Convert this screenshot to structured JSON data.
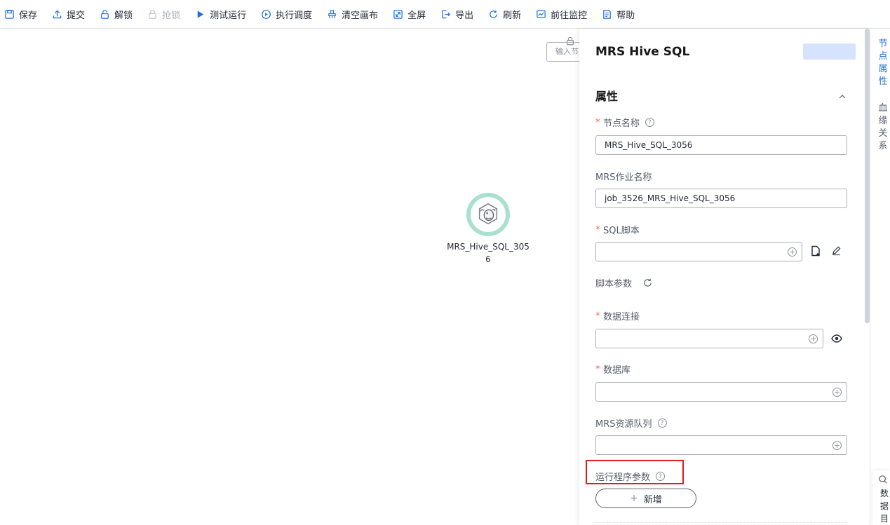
{
  "toolbar": {
    "save": "保存",
    "submit": "提交",
    "unlock": "解锁",
    "grab_lock": "抢锁",
    "test_run": "测试运行",
    "schedule": "执行调度",
    "clear_canvas": "清空画布",
    "fullscreen": "全屏",
    "export": "导出",
    "refresh": "刷新",
    "goto_monitor": "前往监控",
    "help": "帮助"
  },
  "canvas": {
    "search_placeholder": "输入节",
    "node": {
      "label": "MRS_Hive_SQL_3056",
      "icon": "hive-bee-icon"
    }
  },
  "panel": {
    "title": "MRS Hive SQL",
    "section": "属性",
    "fields": {
      "node_name_label": "节点名称",
      "node_name_value": "MRS_Hive_SQL_3056",
      "mrs_job_label": "MRS作业名称",
      "mrs_job_value": "job_3526_MRS_Hive_SQL_3056",
      "sql_script_label": "SQL脚本",
      "script_params_label": "脚本参数",
      "data_connection_label": "数据连接",
      "database_label": "数据库",
      "resource_queue_label": "MRS资源队列",
      "run_params_label": "运行程序参数",
      "add_button": "新增",
      "help_glyph": "?",
      "plus_glyph": "+",
      "required_glyph": "*"
    }
  },
  "right_rail": {
    "tab_node_props": "节点属性",
    "tab_lineage": "血缘关系",
    "bottom_tab": "数据目"
  },
  "colors": {
    "accent": "#1d6fde",
    "highlight_border": "#e31b1b",
    "node_ring": "#a9e0cf",
    "required": "#f66f6a"
  }
}
